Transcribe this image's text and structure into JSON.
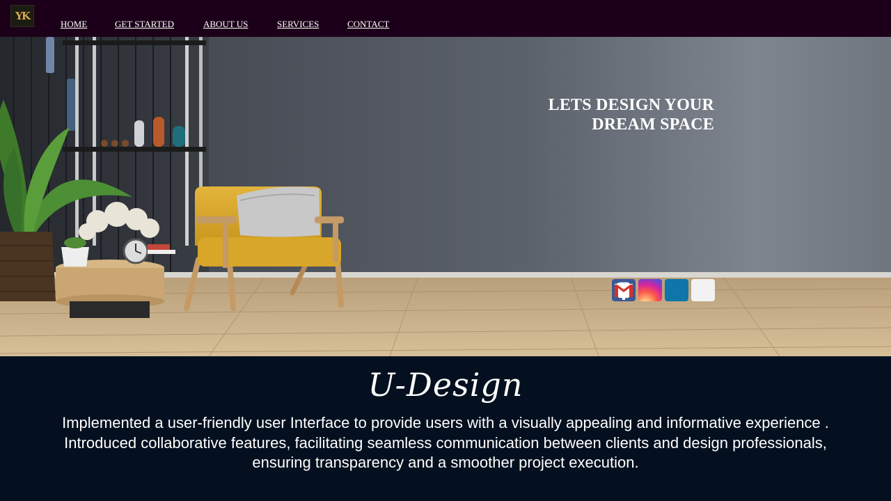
{
  "logo": {
    "text": "YK"
  },
  "nav": {
    "items": [
      {
        "label": "HOME"
      },
      {
        "label": "GET STARTED"
      },
      {
        "label": "ABOUT US"
      },
      {
        "label": "SERVICES"
      },
      {
        "label": "CONTACT"
      }
    ]
  },
  "hero": {
    "tagline_line1": "LETS DESIGN YOUR",
    "tagline_line2": "DREAM SPACE",
    "social_icons": [
      "facebook-icon",
      "instagram-icon",
      "linkedin-icon",
      "gmail-icon"
    ]
  },
  "brand": {
    "title": "U-Design"
  },
  "description": {
    "line1": "Implemented a user-friendly user Interface to provide users with a visually appealing and informative experience .",
    "line2": "Introduced collaborative features, facilitating seamless communication between clients and design professionals,",
    "line3": "ensuring transparency and a smoother project execution."
  },
  "colors": {
    "navbar": "#1c0019",
    "footer": "#04101f",
    "wall": "#5d636d",
    "floor": "#c9ad85",
    "chair": "#d9a92d"
  }
}
